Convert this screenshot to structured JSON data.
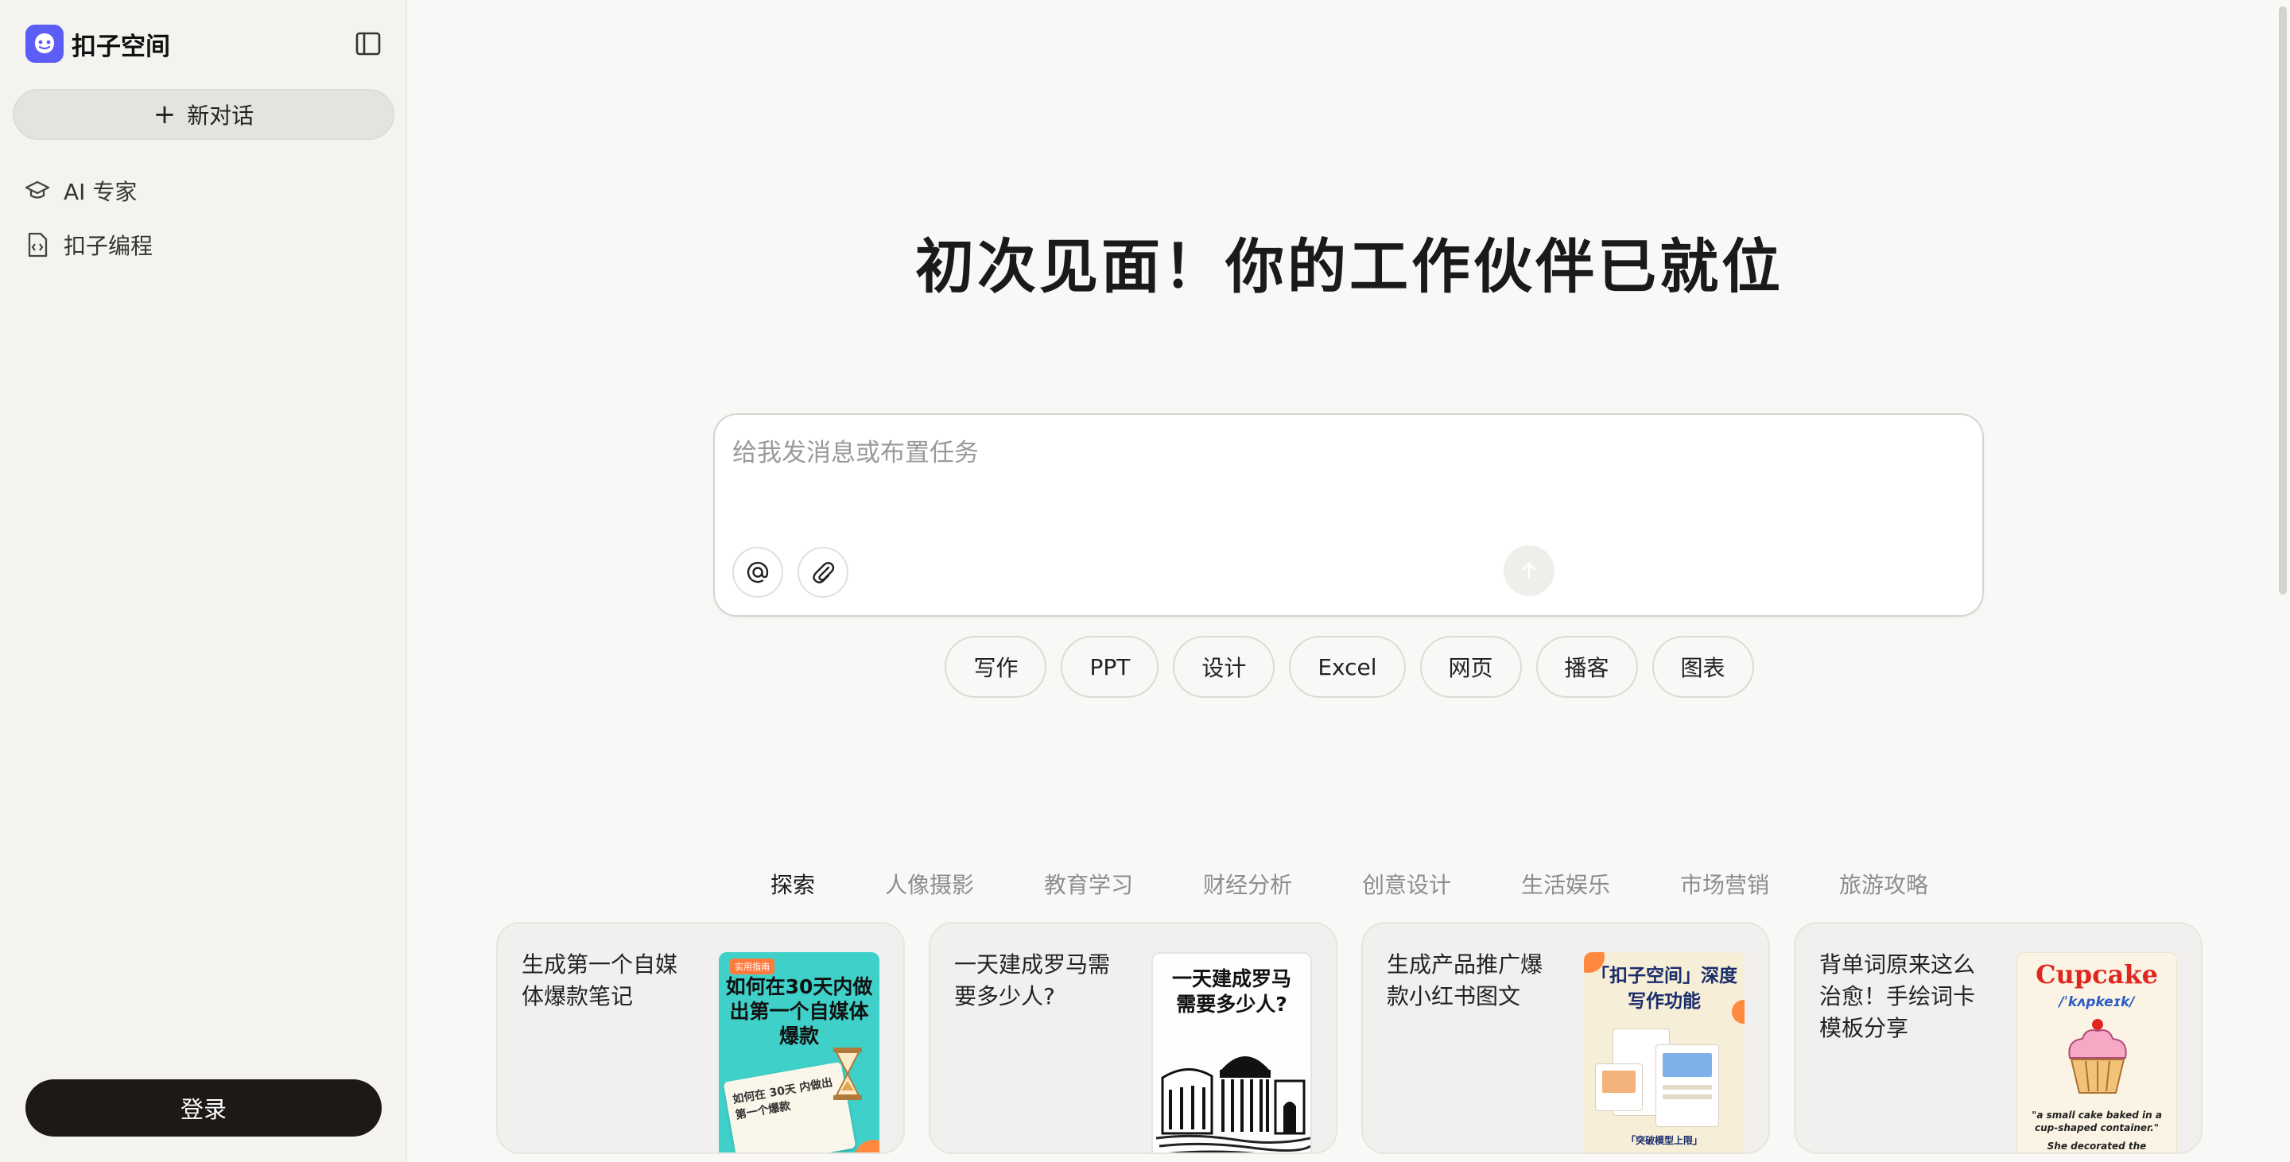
{
  "sidebar": {
    "brand": "扣子空间",
    "new_chat": "新对话",
    "nav": [
      {
        "label": "AI 专家",
        "icon": "graduation-cap-icon"
      },
      {
        "label": "扣子编程",
        "icon": "code-file-icon"
      }
    ],
    "login": "登录"
  },
  "main": {
    "greeting": "初次见面！你的工作伙伴已就位",
    "input_placeholder": "给我发消息或布置任务",
    "chips": [
      "写作",
      "PPT",
      "设计",
      "Excel",
      "网页",
      "播客",
      "图表"
    ],
    "categories": [
      "探索",
      "人像摄影",
      "教育学习",
      "财经分析",
      "创意设计",
      "生活娱乐",
      "市场营销",
      "旅游攻略"
    ],
    "active_category": 0,
    "cards": [
      {
        "title": "生成第一个自媒体爆款笔记",
        "thumb": {
          "tag": "实用指南",
          "headline": "如何在30天内做出第一个自媒体爆款",
          "sub": "如何在 30天 内做出第一个爆款"
        }
      },
      {
        "title": "一天建成罗马需要多少人?",
        "thumb": {
          "headline": "一天建成罗马需要多少人?"
        }
      },
      {
        "title": "生成产品推广爆款小红书图文",
        "thumb": {
          "headline": "「扣子空间」深度写作功能",
          "footer": "「突破模型上限」"
        }
      },
      {
        "title": "背单词原来这么治愈！手绘词卡模板分享",
        "thumb": {
          "word": "Cupcake",
          "phonetic": "/ˈkʌpkeɪk/",
          "definition": "\"a small cake baked in a cup-shaped container.\"",
          "example": "She decorated the"
        }
      }
    ]
  },
  "colors": {
    "brand": "#5b5df5",
    "login_bg": "#1c1917",
    "sidebar_bg": "#f4f3f0",
    "page_bg": "#f9f8f6"
  }
}
